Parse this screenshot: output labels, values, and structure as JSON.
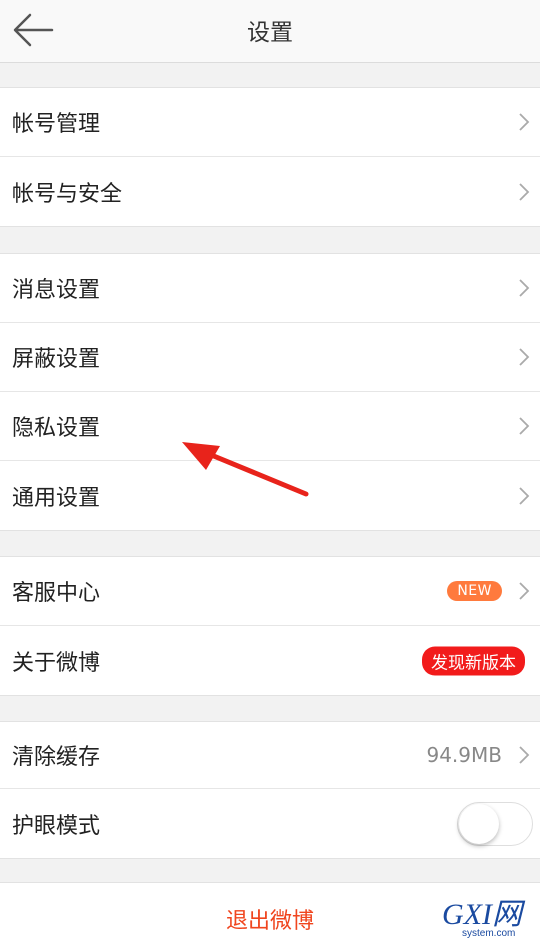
{
  "header": {
    "title": "设置",
    "back_icon": "arrow-left-icon"
  },
  "groups": [
    {
      "items": [
        {
          "label": "帐号管理"
        },
        {
          "label": "帐号与安全"
        }
      ]
    },
    {
      "items": [
        {
          "label": "消息设置"
        },
        {
          "label": "屏蔽设置"
        },
        {
          "label": "隐私设置"
        },
        {
          "label": "通用设置"
        }
      ]
    },
    {
      "items": [
        {
          "label": "客服中心",
          "badge": "NEW"
        },
        {
          "label": "关于微博",
          "badge": "发现新版本"
        }
      ]
    },
    {
      "items": [
        {
          "label": "清除缓存",
          "value": "94.9MB"
        },
        {
          "label": "护眼模式",
          "toggle": false
        }
      ]
    }
  ],
  "logout": {
    "label": "退出微博"
  },
  "watermark": {
    "main": "GXI网",
    "sub": "system.com"
  },
  "colors": {
    "accent_red": "#f0451e",
    "badge_new": "#ff7a3d",
    "badge_version": "#f21b1b",
    "annotation_arrow": "#e8231b"
  }
}
